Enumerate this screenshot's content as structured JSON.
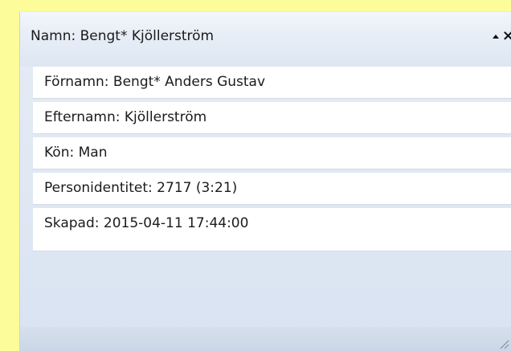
{
  "panel": {
    "title": "Namn: Bengt* Kjöllerström",
    "collapse_icon": "collapse-up-icon",
    "close_icon": "close-icon",
    "close_glyph": "×"
  },
  "fields": [
    "Förnamn: Bengt* Anders Gustav",
    "Efternamn: Kjöllerström",
    "Kön: Man",
    "Personidentitet: 2717 (3:21)",
    "Skapad: 2015-04-11 17:44:00"
  ],
  "colors": {
    "background": "#fcfc9a",
    "panel": "#e4ebf5",
    "field_background": "#ffffff"
  }
}
